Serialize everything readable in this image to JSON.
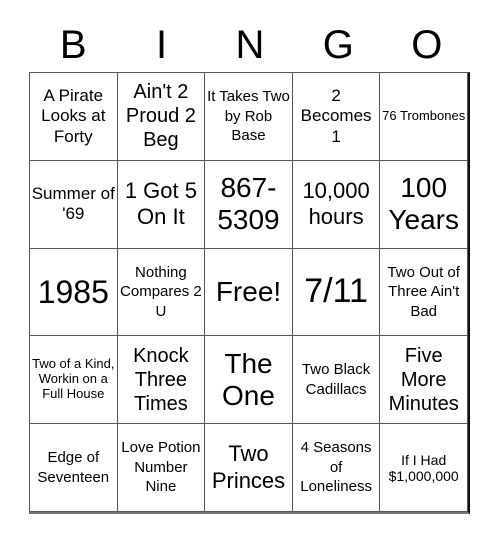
{
  "header": [
    "B",
    "I",
    "N",
    "G",
    "O"
  ],
  "cells": [
    [
      "A Pirate Looks at Forty",
      "Ain't 2 Proud 2 Beg",
      "It Takes Two by Rob Base",
      "2 Becomes 1",
      "76 Trombones"
    ],
    [
      "Summer of '69",
      "1 Got 5 On It",
      "867-5309",
      "10,000 hours",
      "100 Years"
    ],
    [
      "1985",
      "Nothing Compares 2 U",
      "Free!",
      "7/11",
      "Two Out of Three Ain't Bad"
    ],
    [
      "Two of a Kind, Workin on a Full House",
      "Knock Three Times",
      "The One",
      "Two Black Cadillacs",
      "Five More Minutes"
    ],
    [
      "Edge of Seventeen",
      "Love Potion Number Nine",
      "Two Princes",
      "4 Seasons of Loneliness",
      "If I Had $1,000,000"
    ]
  ]
}
